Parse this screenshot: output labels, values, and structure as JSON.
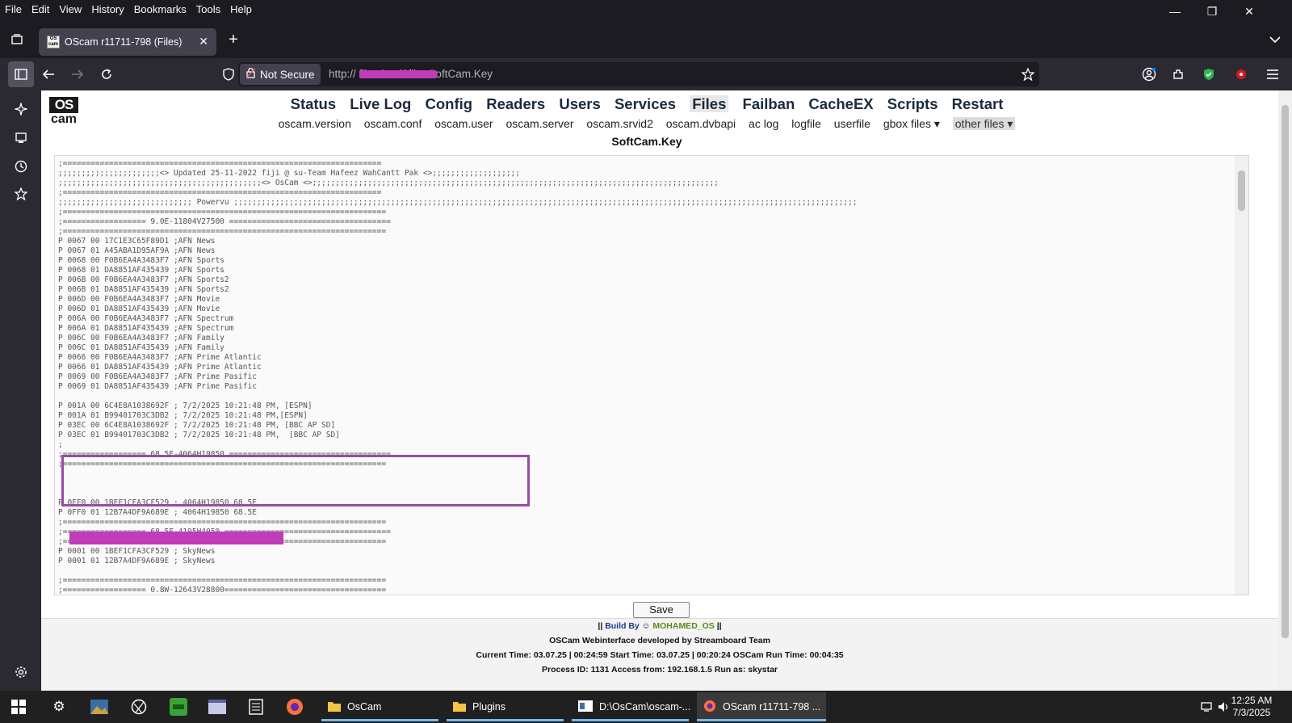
{
  "menubar": {
    "items": [
      "File",
      "Edit",
      "View",
      "History",
      "Bookmarks",
      "Tools",
      "Help"
    ]
  },
  "window": {
    "minimize": "—",
    "restore": "❐",
    "close": "✕"
  },
  "tab": {
    "title": "OScam r11711-798 (Files)",
    "close": "✕",
    "new": "+"
  },
  "navbar": {
    "security_label": "Not Secure",
    "url": "http://                    files.html?file=SoftCam.Key"
  },
  "page": {
    "logo_top": "OS",
    "logo_bottom": "cam",
    "main_nav": [
      "Status",
      "Live Log",
      "Config",
      "Readers",
      "Users",
      "Services",
      "Files",
      "Failban",
      "CacheEX",
      "Scripts",
      "Restart"
    ],
    "active_main": "Files",
    "sub_nav": [
      "oscam.version",
      "oscam.conf",
      "oscam.user",
      "oscam.server",
      "oscam.srvid2",
      "oscam.dvbapi",
      "ac log",
      "logfile",
      "userfile",
      "gbox files ▾",
      "other files ▾"
    ],
    "file_title": "SoftCam.Key",
    "save_label": "Save",
    "editor_text": ";=====================================================================\n;;;;;;;;;;;;;;;;;;;;;;<> Updated 25-11-2022 fiji @ su-Team Hafeez WahCantt Pak <>;;;;;;;;;;;;;;;;;;;\n;;;;;;;;;;;;;;;;;;;;;;;;;;;;;;;;;;;;;;;;;;;;<> OsCam <>;;;;;;;;;;;;;;;;;;;;;;;;;;;;;;;;;;;;;;;;;;;;;;;;;;;;;;;;;;;;;;;;;;;;;;;;;;;;;;;;;;;;;;;;\n;=====================================================================\n;;;;;;;;;;;;;;;;;;;;;;;;;;;;; Powervu ;;;;;;;;;;;;;;;;;;;;;;;;;;;;;;;;;;;;;;;;;;;;;;;;;;;;;;;;;;;;;;;;;;;;;;;;;;;;;;;;;;;;;;;;;;;;;;;;;;;;;;;;;;;;;;;;;;;;;;;;;;;;;;;;;;;;;;;\n;======================================================================\n;================== 9.0E-11804V27500 ===================================\n;======================================================================\nP 0067 00 17C1E3C65F89D1 ;AFN News\nP 0067 01 A45ABA1D95AF9A ;AFN News\nP 0068 00 F0B6EA4A3483F7 ;AFN Sports\nP 0068 01 DA8851AF435439 ;AFN Sports\nP 006B 00 F0B6EA4A3483F7 ;AFN Sports2\nP 006B 01 DA8851AF435439 ;AFN Sports2\nP 006D 00 F0B6EA4A3483F7 ;AFN Movie\nP 006D 01 DA8851AF435439 ;AFN Movie\nP 006A 00 F0B6EA4A3483F7 ;AFN Spectrum\nP 006A 01 DA8851AF435439 ;AFN Spectrum\nP 006C 00 F0B6EA4A3483F7 ;AFN Family\nP 006C 01 DA8851AF435439 ;AFN Family\nP 0066 00 F0B6EA4A3483F7 ;AFN Prime Atlantic\nP 0066 01 DA8851AF435439 ;AFN Prime Atlantic\nP 0069 00 F0B6EA4A3483F7 ;AFN Prime Pasific\nP 0069 01 DA8851AF435439 ;AFN Prime Pasific\n\nP 001A 00 6C4E8A1038692F ; 7/2/2025 10:21:48 PM, [ESPN]\nP 001A 01 B99401703C3DB2 ; 7/2/2025 10:21:48 PM,[ESPN]\nP 03EC 00 6C4E8A1038692F ; 7/2/2025 10:21:48 PM, [BBC AP SD]\nP 03EC 01 B99401703C3DB2 ; 7/2/2025 10:21:48 PM,  [BBC AP SD]\n;\n;================== 68.5E-4064H19850 ===================================\n;======================================================================\n\n\n\nP 0FF0 00 1BEF1CFA3CF529 ; 4064H19850 68.5E\nP 0FF0 01 12B7A4DF9A689E ; 4064H19850 68.5E\n;======================================================================\n;================== 68.5E-4195H4050 ====================================\n;======================================================================\nP 0001 00 1BEF1CFA3CF529 ; SkyNews\nP 0001 01 12B7A4DF9A689E ; SkyNews\n\n;======================================================================\n;================== 0.8W-12643V28800===================================\n;======================================================================",
    "footer": {
      "build_prefix": "||",
      "build_label": "Build By",
      "build_author": "MOHAMED_OS",
      "build_suffix": "||",
      "developed": "OSCam Webinterface developed by Streamboard Team",
      "times": "Current Time: 03.07.25 | 00:24:59 Start Time: 03.07.25 | 00:20:24 OSCam Run Time: 00:04:35",
      "process": "Process ID: 1131 Access from: 192.168.1.5 Run as: skystar"
    }
  },
  "taskbar": {
    "apps": [
      "OsCam",
      "Plugins",
      "D:\\OsCam\\oscam-...",
      "OScam r11711-798 ..."
    ],
    "time": "12:25 AM",
    "date": "7/3/2025"
  },
  "colors": {
    "highlight_box": "#9b4aa6",
    "redaction": "#c03cb8",
    "accent": "#76b9ed"
  }
}
